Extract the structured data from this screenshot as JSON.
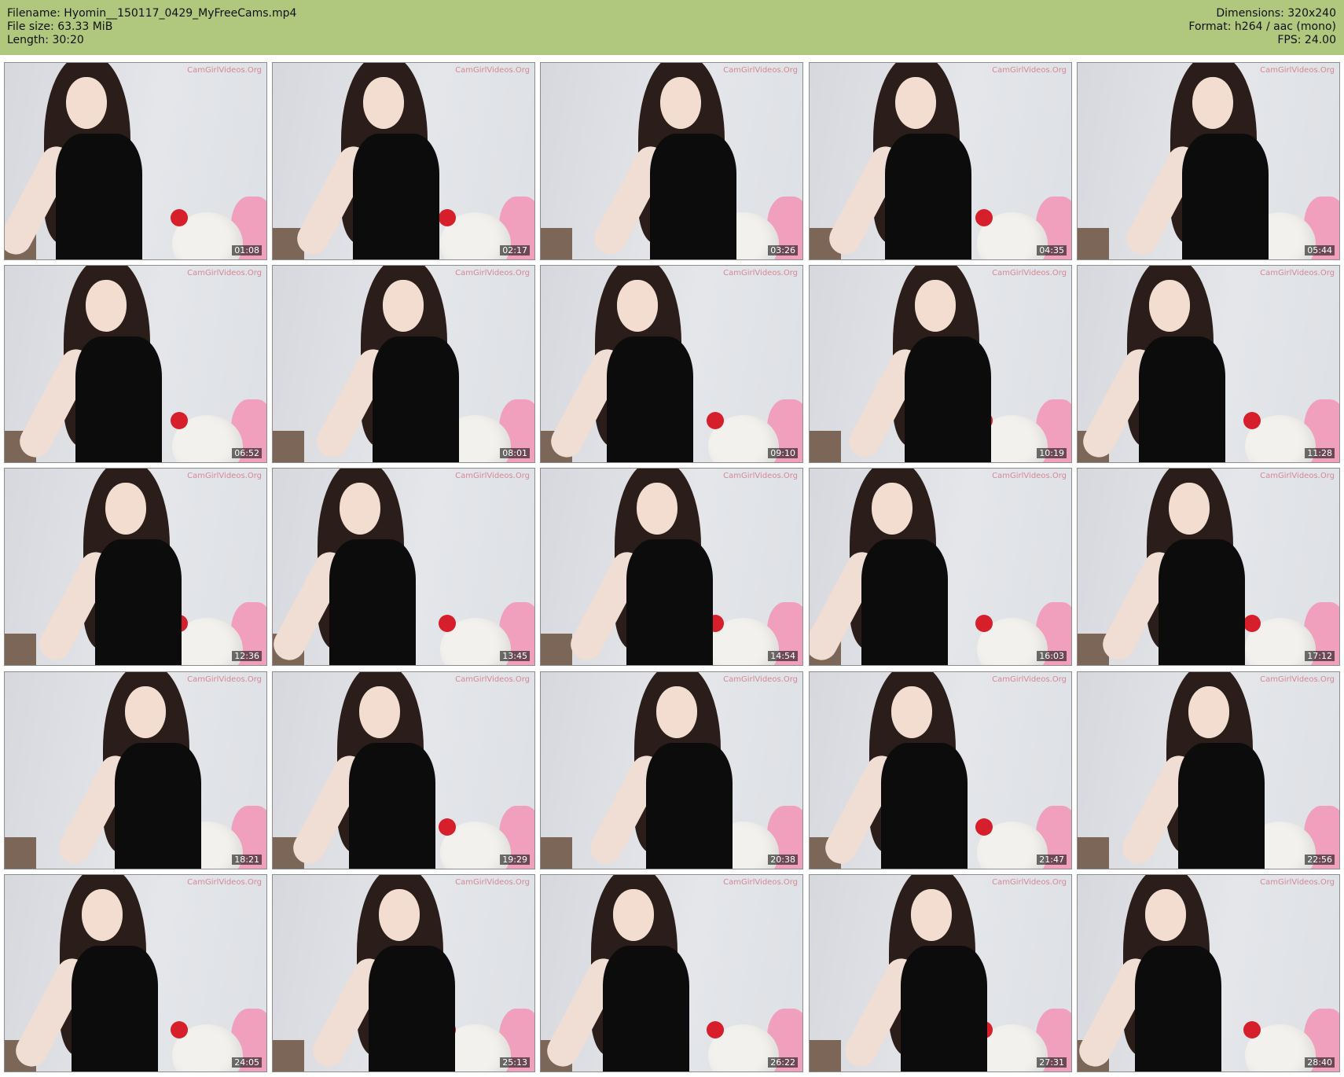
{
  "header": {
    "filename": "Filename: Hyomin__150117_0429_MyFreeCams.mp4",
    "filesize": "File size: 63.33 MiB",
    "length": "Length: 30:20",
    "dimensions": "Dimensions: 320x240",
    "format": "Format: h264 / aac (mono)",
    "fps": "FPS: 24.00",
    "background_color": "#b0c77e"
  },
  "watermark": "CamGirlVideos.Org",
  "thumbnails": [
    {
      "time": "01:08"
    },
    {
      "time": "02:17"
    },
    {
      "time": "03:26"
    },
    {
      "time": "04:35"
    },
    {
      "time": "05:44"
    },
    {
      "time": "06:52"
    },
    {
      "time": "08:01"
    },
    {
      "time": "09:10"
    },
    {
      "time": "10:19"
    },
    {
      "time": "11:28"
    },
    {
      "time": "12:36"
    },
    {
      "time": "13:45"
    },
    {
      "time": "14:54"
    },
    {
      "time": "16:03"
    },
    {
      "time": "17:12"
    },
    {
      "time": "18:21"
    },
    {
      "time": "19:29"
    },
    {
      "time": "20:38"
    },
    {
      "time": "21:47"
    },
    {
      "time": "22:56"
    },
    {
      "time": "24:05"
    },
    {
      "time": "25:13"
    },
    {
      "time": "26:22"
    },
    {
      "time": "27:31"
    },
    {
      "time": "28:40"
    }
  ]
}
